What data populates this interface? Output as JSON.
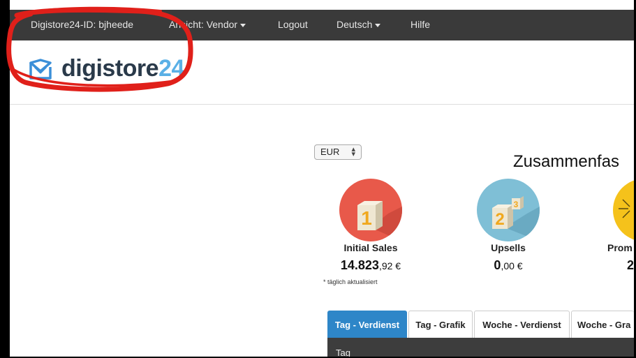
{
  "topbar": {
    "account_id": "Digistore24-ID: bjheede",
    "view_menu": "Ansicht: Vendor",
    "logout": "Logout",
    "language": "Deutsch",
    "help": "Hilfe"
  },
  "logo": {
    "text": "digistore",
    "number": "24"
  },
  "currency": {
    "selected": "EUR"
  },
  "summary": {
    "title": "Zusammenfas"
  },
  "stats": [
    {
      "label": "Initial Sales",
      "value_main": "14.823",
      "value_cents": ",92 €",
      "color": "#e8594a"
    },
    {
      "label": "Upsells",
      "value_main": "0",
      "value_cents": ",00 €",
      "color": "#7fbfd6"
    },
    {
      "label": "Prom",
      "value_main": "2",
      "value_cents": "",
      "color": "#f5c21b"
    }
  ],
  "note": "* täglich aktualisiert",
  "tabs": [
    {
      "label": "Tag - Verdienst",
      "active": true
    },
    {
      "label": "Tag - Grafik",
      "active": false
    },
    {
      "label": "Woche - Verdienst",
      "active": false
    },
    {
      "label": "Woche - Gra",
      "active": false
    }
  ],
  "table": {
    "first_column": "Tag"
  },
  "colors": {
    "topbar": "#3a3a3a",
    "active_tab": "#2e86c8",
    "annotation": "#e0201a"
  }
}
